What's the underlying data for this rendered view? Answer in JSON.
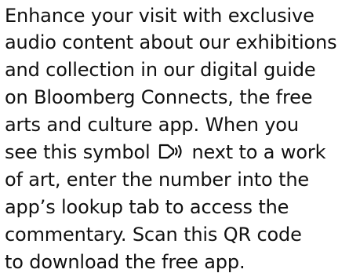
{
  "info_text": {
    "lines": [
      "Enhance your visit with exclusive",
      "audio content about our exhibitions",
      "and collection in our digital guide",
      "on Bloomberg Connects, the free",
      "arts and culture app. When you",
      "see this symbol",
      "next to a work",
      "of art, enter the number into the",
      "app’s lookup tab to access the",
      "commentary. Scan this QR code",
      "to download the free app."
    ],
    "symbol_icon": "audio-speaker-icon",
    "text_color": "#111111",
    "background_color": "#ffffff"
  }
}
